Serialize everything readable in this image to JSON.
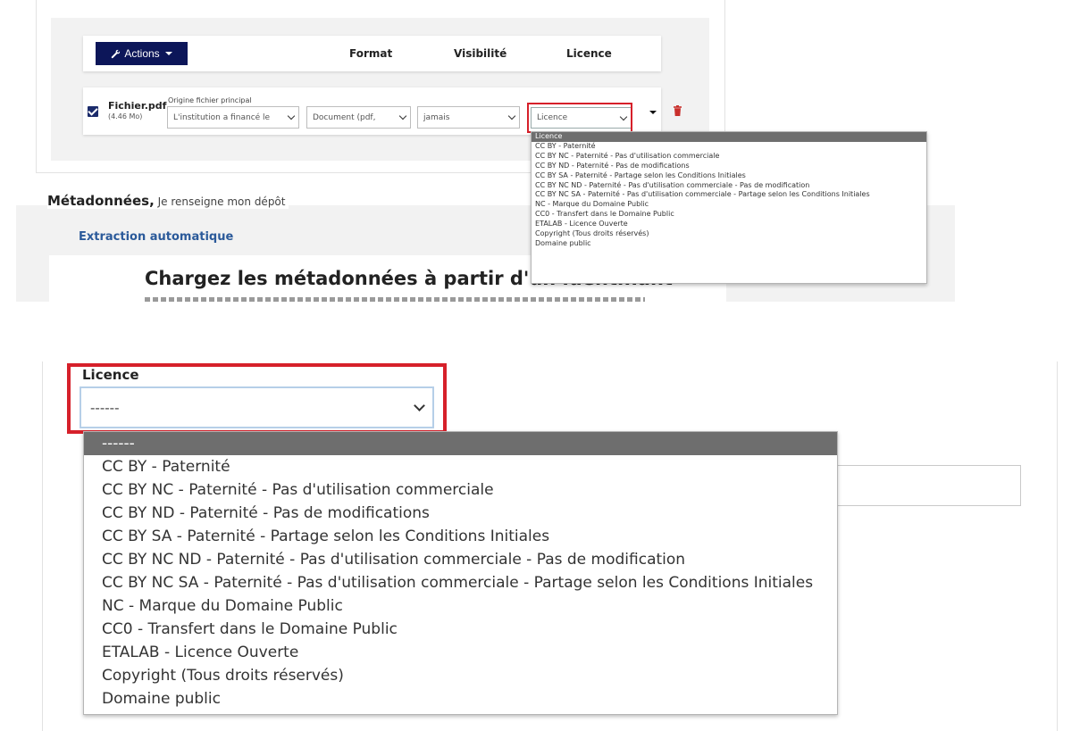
{
  "top": {
    "actions_label": "Actions",
    "columns": {
      "format": "Format",
      "visibility": "Visibilité",
      "licence": "Licence"
    },
    "file": {
      "name": "Fichier.pdf",
      "size": "(4.46 Mo)",
      "origin_label": "Origine fichier principal",
      "origin_value": "L'institution a financé le",
      "format_value": "Document (pdf,",
      "visibility_value": "jamais",
      "licence_value": "Licence"
    },
    "licence_options": [
      "Licence",
      "CC BY - Paternité",
      "CC BY NC - Paternité - Pas d'utilisation commerciale",
      "CC BY ND - Paternité - Pas de modifications",
      "CC BY SA - Paternité - Partage selon les Conditions Initiales",
      "CC BY NC ND - Paternité - Pas d'utilisation commerciale - Pas de modification",
      "CC BY NC SA - Paternité - Pas d'utilisation commerciale - Partage selon les Conditions Initiales",
      "NC - Marque du Domaine Public",
      "CC0 - Transfert dans le Domaine Public",
      "ETALAB - Licence Ouverte",
      "Copyright (Tous droits réservés)",
      "Domaine public"
    ],
    "metadata_title": "Métadonnées,",
    "metadata_subtitle": " Je renseigne mon dépôt",
    "extraction_label": "Extraction automatique",
    "charge_title": "Chargez les métadonnées à partir d'un identifiant"
  },
  "bottom": {
    "licence_label": "Licence",
    "licence_value": "------",
    "licence_options": [
      "------",
      "CC BY - Paternité",
      "CC BY NC - Paternité - Pas d'utilisation commerciale",
      "CC BY ND - Paternité - Pas de modifications",
      "CC BY SA - Paternité - Partage selon les Conditions Initiales",
      "CC BY NC ND - Paternité - Pas d'utilisation commerciale - Pas de modification",
      "CC BY NC SA - Paternité - Pas d'utilisation commerciale - Partage selon les Conditions Initiales",
      "NC - Marque du Domaine Public",
      "CC0 - Transfert dans le Domaine Public",
      "ETALAB - Licence Ouverte",
      "Copyright (Tous droits réservés)",
      "Domaine public"
    ]
  },
  "colors": {
    "accent_navy": "#0c1659",
    "highlight_red": "#d6202a",
    "selected_option": "#6e6e6e",
    "link_blue": "#2b5a9a"
  },
  "icons": {
    "wrench": "wrench-icon",
    "trash": "trash-icon",
    "checkbox": "checkbox-checked-icon"
  }
}
